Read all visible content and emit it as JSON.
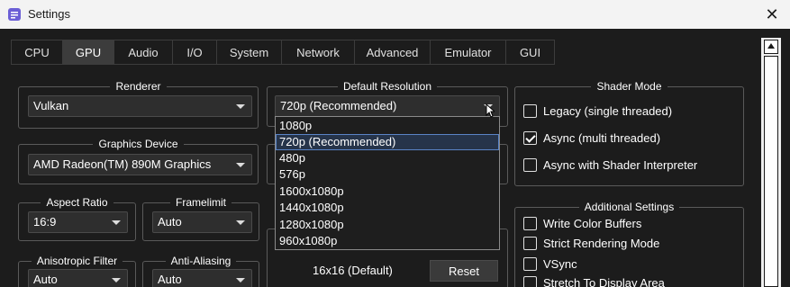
{
  "window": {
    "title": "Settings",
    "close_glyph": "✕",
    "icon": "settings-app-icon"
  },
  "tabs": [
    {
      "label": "CPU",
      "active": false
    },
    {
      "label": "GPU",
      "active": true
    },
    {
      "label": "Audio",
      "active": false
    },
    {
      "label": "I/O",
      "active": false
    },
    {
      "label": "System",
      "active": false
    },
    {
      "label": "Network",
      "active": false
    },
    {
      "label": "Advanced",
      "active": false
    },
    {
      "label": "Emulator",
      "active": false
    },
    {
      "label": "GUI",
      "active": false
    }
  ],
  "renderer": {
    "title": "Renderer",
    "value": "Vulkan"
  },
  "graphics_device": {
    "title": "Graphics Device",
    "value": "AMD Radeon(TM) 890M Graphics"
  },
  "aspect_ratio": {
    "title": "Aspect Ratio",
    "value": "16:9"
  },
  "framelimit": {
    "title": "Framelimit",
    "value": "Auto"
  },
  "anisotropic_filter": {
    "title": "Anisotropic Filter",
    "value": "Auto"
  },
  "anti_aliasing": {
    "title": "Anti-Aliasing",
    "value": "Auto"
  },
  "default_resolution": {
    "title": "Default Resolution",
    "value": "720p (Recommended)",
    "options": [
      "1080p",
      "720p (Recommended)",
      "480p",
      "576p",
      "1600x1080p",
      "1440x1080p",
      "1280x1080p",
      "960x1080p"
    ],
    "selected_index": 1
  },
  "anisotropic_default": {
    "value": "16x16 (Default)",
    "reset_label": "Reset"
  },
  "shader_mode": {
    "title": "Shader Mode",
    "options": [
      {
        "label": "Legacy (single threaded)",
        "checked": false
      },
      {
        "label": "Async (multi threaded)",
        "checked": true
      },
      {
        "label": "Async with Shader Interpreter",
        "checked": false
      }
    ]
  },
  "additional_settings": {
    "title": "Additional Settings",
    "options": [
      {
        "label": "Write Color Buffers",
        "checked": false
      },
      {
        "label": "Strict Rendering Mode",
        "checked": false
      },
      {
        "label": "VSync",
        "checked": false
      },
      {
        "label": "Stretch To Display Area",
        "checked": false
      }
    ]
  },
  "colors": {
    "background": "#1c1c1c",
    "titlebar": "#f3f3f3",
    "selection": "#26344a",
    "selection_border": "#5a84c6",
    "app_icon": "#6b5fd6"
  }
}
